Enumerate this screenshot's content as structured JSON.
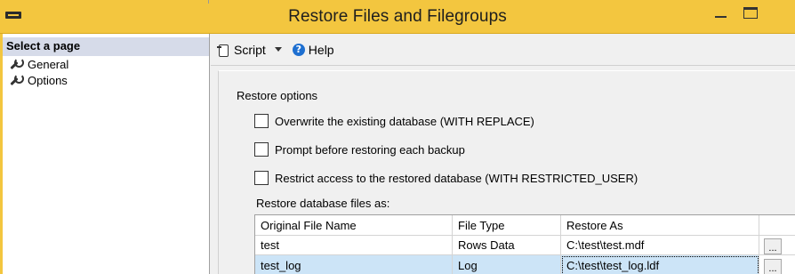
{
  "window": {
    "title": "Restore Files and Filegroups"
  },
  "left_pane": {
    "header": "Select a page",
    "items": [
      {
        "label": "General",
        "icon": "wrench-icon"
      },
      {
        "label": "Options",
        "icon": "wrench-icon"
      }
    ]
  },
  "toolbar": {
    "script_label": "Script",
    "help_label": "Help"
  },
  "options": {
    "section_title": "Restore options",
    "checkboxes": [
      {
        "label": "Overwrite the existing database (WITH REPLACE)",
        "checked": false
      },
      {
        "label": "Prompt before restoring each backup",
        "checked": false
      },
      {
        "label": "Restrict access to the restored database (WITH RESTRICTED_USER)",
        "checked": false
      }
    ],
    "files_label": "Restore database files as:"
  },
  "files_grid": {
    "columns": [
      "Original File Name",
      "File Type",
      "Restore As"
    ],
    "rows": [
      {
        "original": "test",
        "type": "Rows Data",
        "restore_as": "C:\\test\\test.mdf",
        "button": "..."
      },
      {
        "original": "test_log",
        "type": "Log",
        "restore_as": "C:\\test\\test_log.ldf",
        "button": "..."
      }
    ]
  },
  "colors": {
    "title_bar": "#f3c63f",
    "selected_row": "#cce4f7",
    "page_header": "#d6dbe9"
  }
}
